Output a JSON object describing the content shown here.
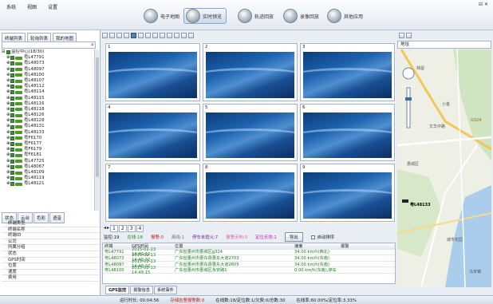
{
  "menu": [
    "系统",
    "视图",
    "设置"
  ],
  "nav": [
    {
      "label": "电子地图",
      "active": false
    },
    {
      "label": "实时预览",
      "active": true
    },
    {
      "label": "轨迹回放",
      "active": false
    },
    {
      "label": "录像回放",
      "active": false
    },
    {
      "label": "其他应用",
      "active": false
    }
  ],
  "window_controls": "⊟ ✕",
  "left_tabs": [
    "终端列表",
    "轮询列表",
    "我的地图"
  ],
  "tree": {
    "root": "监控中心(18/30)",
    "items": [
      "粤L47791",
      "粤L48073",
      "粤L48097",
      "粤L48100",
      "粤L48107",
      "粤L48112",
      "粤L48114",
      "粤L48115",
      "粤L48116",
      "粤L48118",
      "粤L48126",
      "粤L48128",
      "粤L48131",
      "粤L48133",
      "粤F6170",
      "粤F6177",
      "粤F6179",
      "粤F6181",
      "粤L47725",
      "粤L48067",
      "粤L48109",
      "粤L48119",
      "粤L48121"
    ]
  },
  "left_bottom_tabs": [
    "状态",
    "云台",
    "色彩",
    "语音"
  ],
  "properties": [
    "终端类型",
    "终端名称",
    "终端ID",
    "公司",
    "所属分组",
    "状态",
    "GPS时间",
    "位置",
    "速度",
    "费用"
  ],
  "cells": [
    "1",
    "2",
    "3",
    "4",
    "5",
    "6",
    "7",
    "8",
    "9"
  ],
  "pages": [
    "1",
    "2",
    "3",
    "4"
  ],
  "stats": {
    "monitor": "监控:19",
    "online": "在线:18",
    "alarm": "报警:0",
    "offline": "离线:1",
    "parked": "停车未熄火:7",
    "alarmed": "报警无响:0",
    "noloc": "定位无效:1",
    "export": "导出",
    "autosort": "自动排序"
  },
  "table": {
    "headers": [
      "终端",
      "GPS时间",
      "位置",
      "速度",
      "报警"
    ],
    "rows": [
      [
        "粤L47791",
        "2015-02-13 14:49:12",
        "广东省惠州市惠城区g324",
        "34.00 km/h(西北)",
        ""
      ],
      [
        "粤L48073",
        "2015-02-13 14:49:32",
        "广东省惠州市惠东县惠东大道2703",
        "34.00 km/h(东南)",
        ""
      ],
      [
        "粤L48097",
        "2015-02-13 14:49:32",
        "广东省惠州市惠东县惠东大道2605",
        "34.00 km/h(东南)",
        ""
      ],
      [
        "粤L48100",
        "2015-02-13 14:49:15",
        "广东省惠州市惠城区永安路1",
        "0.00 km/h(东南),停车",
        ""
      ]
    ]
  },
  "bottom_tabs": [
    "GPS监控",
    "报警信息",
    "系统事件"
  ],
  "map": {
    "addr_label": "地址",
    "labels": [
      "林屋",
      "小金",
      "文华中路",
      "惠城区",
      "粤L48133",
      "城市花园",
      "G324",
      "马安镇"
    ]
  },
  "status": {
    "runtime": "运行时长: 00:04:56",
    "alarmcount": "存储告警报警数:0",
    "online": "在线数:18/定位数:1/欠费:0/总数:30",
    "rate": "在线率:60.00%/定位率:3.33%"
  }
}
